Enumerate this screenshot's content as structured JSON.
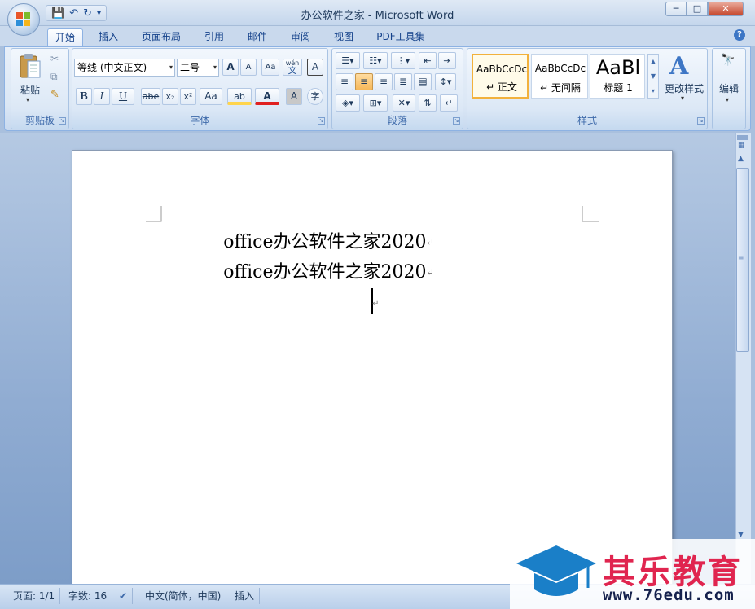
{
  "window": {
    "title": "办公软件之家 - Microsoft Word",
    "min_label": "─",
    "max_label": "□",
    "close_label": "✕"
  },
  "qat": {
    "save_icon": "💾",
    "undo_icon": "↶",
    "redo_icon": "↻",
    "customize_icon": "▾"
  },
  "tabs": [
    {
      "label": "开始",
      "active": true
    },
    {
      "label": "插入"
    },
    {
      "label": "页面布局"
    },
    {
      "label": "引用"
    },
    {
      "label": "邮件"
    },
    {
      "label": "审阅"
    },
    {
      "label": "视图"
    },
    {
      "label": "PDF工具集"
    }
  ],
  "help_icon": "?",
  "ribbon": {
    "clipboard": {
      "label": "剪贴板",
      "paste_label": "粘贴"
    },
    "font": {
      "label": "字体",
      "font_name": "等线 (中文正文)",
      "font_size": "二号",
      "grow": "A",
      "shrink": "A",
      "phonetic": "wén",
      "phonetic_char": "文",
      "border_char": "A",
      "bold": "B",
      "italic": "I",
      "underline": "U",
      "strike": "abe",
      "subscript": "x₂",
      "superscript": "x²",
      "change_case": "Aa",
      "highlight": "ab",
      "font_color": "A",
      "char_shading": "A",
      "enclose": "字"
    },
    "paragraph": {
      "label": "段落"
    },
    "styles": {
      "label": "样式",
      "tiles": [
        {
          "sample": "AaBbCcDc",
          "name": "↵ 正文",
          "selected": true
        },
        {
          "sample": "AaBbCcDc",
          "name": "↵ 无间隔"
        },
        {
          "sample": "AaBl",
          "name": "标题 1"
        }
      ],
      "change_styles": "更改样式"
    },
    "editing": {
      "label": "编辑"
    }
  },
  "document": {
    "lines": [
      "office办公软件之家2020",
      "office办公软件之家2020"
    ],
    "para_mark": "↵"
  },
  "status": {
    "page": "页面: 1/1",
    "words": "字数: 16",
    "language": "中文(简体，中国)",
    "mode": "插入"
  },
  "watermark": {
    "brand": "其乐教育",
    "url": "www.76edu.com"
  },
  "colors": {
    "accent": "#15428b",
    "highlight": "#ffd44c",
    "font_red": "#e02020",
    "brand_red": "#e0254f"
  }
}
